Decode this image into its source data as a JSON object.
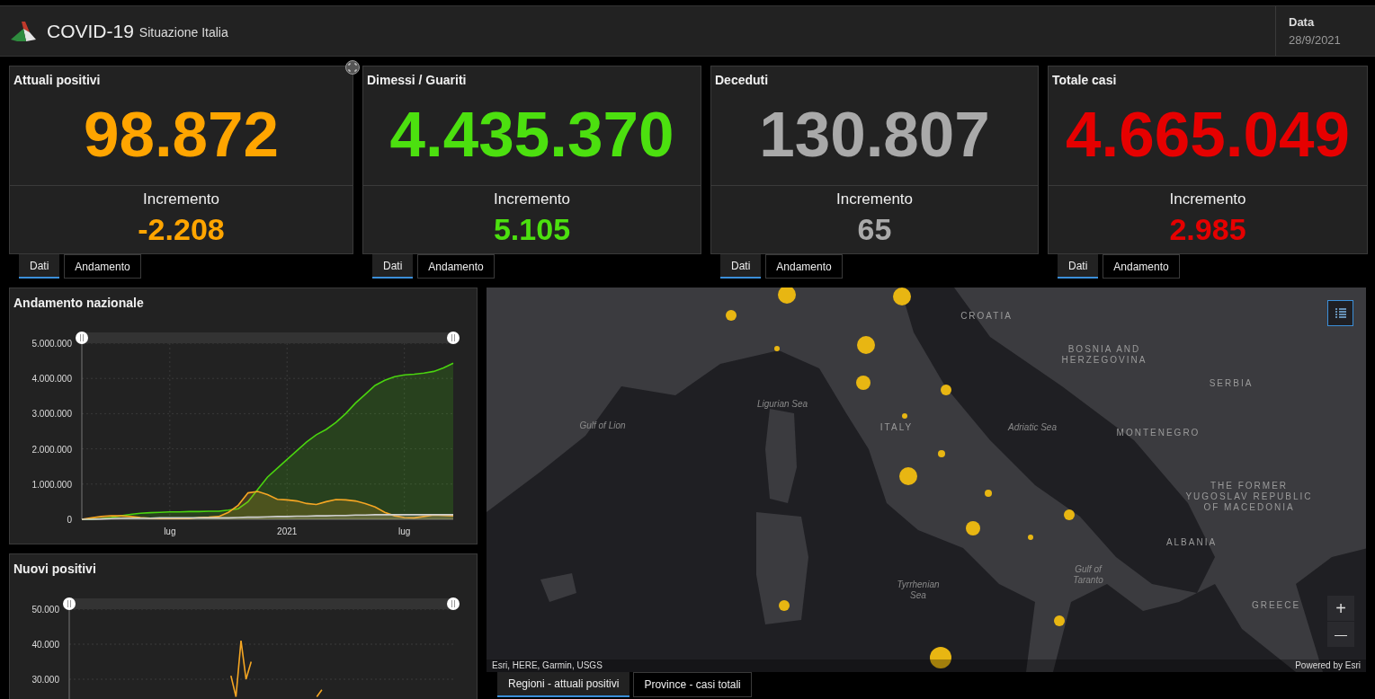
{
  "header": {
    "title": "COVID-19",
    "subtitle": "Situazione Italia",
    "date_label": "Data",
    "date_value": "28/9/2021"
  },
  "cards": [
    {
      "title": "Attuali positivi",
      "value": "98.872",
      "increment_label": "Incremento",
      "increment": "-2.208",
      "color": "#ffa500",
      "tabs": [
        {
          "label": "Dati",
          "selected": true
        },
        {
          "label": "Andamento",
          "selected": false
        }
      ]
    },
    {
      "title": "Dimessi / Guariti",
      "value": "4.435.370",
      "increment_label": "Incremento",
      "increment": "5.105",
      "color": "#4ce00f",
      "tabs": [
        {
          "label": "Dati",
          "selected": true
        },
        {
          "label": "Andamento",
          "selected": false
        }
      ]
    },
    {
      "title": "Deceduti",
      "value": "130.807",
      "increment_label": "Incremento",
      "increment": "65",
      "color": "#a9a9a9",
      "tabs": [
        {
          "label": "Dati",
          "selected": true
        },
        {
          "label": "Andamento",
          "selected": false
        }
      ]
    },
    {
      "title": "Totale casi",
      "value": "4.665.049",
      "increment_label": "Incremento",
      "increment": "2.985",
      "color": "#e60000",
      "tabs": [
        {
          "label": "Dati",
          "selected": true
        },
        {
          "label": "Andamento",
          "selected": false
        }
      ]
    }
  ],
  "charts": [
    {
      "title": "Andamento nazionale",
      "chart_data": {
        "type": "area",
        "categories": [
          null,
          null,
          null,
          null,
          null,
          null,
          null,
          null,
          null,
          "lug",
          null,
          null,
          null,
          null,
          null,
          null,
          null,
          null,
          null,
          null,
          null,
          "2021",
          null,
          null,
          null,
          null,
          null,
          null,
          null,
          null,
          null,
          null,
          null,
          "lug",
          null,
          null,
          null,
          null,
          null
        ],
        "ylim": [
          0,
          5000000
        ],
        "yticks": [
          {
            "value": 0,
            "label": "0"
          },
          {
            "value": 1000000,
            "label": "1.000.000"
          },
          {
            "value": 2000000,
            "label": "2.000.000"
          },
          {
            "value": 3000000,
            "label": "3.000.000"
          },
          {
            "value": 4000000,
            "label": "4.000.000"
          },
          {
            "value": 5000000,
            "label": "5.000.000"
          }
        ],
        "series": [
          {
            "color": "#4ad40f",
            "values": [
              0,
              10000,
              20000,
              50000,
              100000,
              140000,
              170000,
              190000,
              200000,
              210000,
              210000,
              220000,
              220000,
              230000,
              230000,
              260000,
              300000,
              500000,
              850000,
              1200000,
              1450000,
              1700000,
              1950000,
              2200000,
              2400000,
              2550000,
              2750000,
              3000000,
              3300000,
              3550000,
              3800000,
              3950000,
              4050000,
              4100000,
              4120000,
              4150000,
              4200000,
              4300000,
              4430000
            ]
          },
          {
            "color": "#f5a623",
            "values": [
              0,
              40000,
              80000,
              100000,
              100000,
              80000,
              50000,
              30000,
              20000,
              20000,
              20000,
              20000,
              50000,
              60000,
              80000,
              200000,
              400000,
              750000,
              790000,
              700000,
              570000,
              550000,
              520000,
              450000,
              420000,
              500000,
              560000,
              550000,
              520000,
              450000,
              350000,
              200000,
              100000,
              50000,
              40000,
              80000,
              120000,
              110000,
              100000
            ]
          },
          {
            "color": "#cfcfcf",
            "values": [
              0,
              0,
              10000,
              20000,
              30000,
              30000,
              30000,
              30000,
              40000,
              40000,
              40000,
              40000,
              40000,
              40000,
              40000,
              40000,
              50000,
              60000,
              60000,
              70000,
              80000,
              80000,
              90000,
              90000,
              100000,
              100000,
              110000,
              110000,
              120000,
              120000,
              130000,
              130000,
              130000,
              130000,
              130000,
              130000,
              130000,
              130000,
              130000
            ]
          }
        ],
        "grid": true
      }
    },
    {
      "title": "Nuovi positivi",
      "chart_data": {
        "type": "line",
        "categories": [
          null,
          null,
          null,
          null,
          null,
          null,
          null,
          null,
          null,
          null,
          null,
          null,
          null,
          null,
          null,
          null,
          null,
          null,
          null,
          null,
          null,
          null,
          null,
          null,
          null,
          null,
          null,
          null,
          null,
          null,
          null,
          null,
          null,
          null,
          null,
          null,
          null,
          null,
          null,
          null,
          null,
          null,
          null,
          null,
          null,
          null,
          null,
          null,
          null,
          null,
          null,
          null,
          null,
          null,
          null,
          null,
          null,
          null,
          null,
          null,
          null,
          null,
          null,
          null,
          null,
          null,
          null,
          null,
          null,
          null,
          null,
          null,
          null,
          null,
          null,
          null,
          null
        ],
        "ylim": [
          0,
          50000
        ],
        "yticks": [
          {
            "value": 30000,
            "label": "30.000"
          },
          {
            "value": 40000,
            "label": "40.000"
          },
          {
            "value": 50000,
            "label": "50.000"
          }
        ],
        "series": [
          {
            "color": "#f5a623",
            "values": [
              null,
              null,
              null,
              null,
              null,
              null,
              null,
              null,
              null,
              null,
              null,
              null,
              null,
              null,
              null,
              null,
              null,
              null,
              null,
              null,
              null,
              null,
              null,
              null,
              null,
              null,
              null,
              null,
              null,
              null,
              null,
              null,
              31000,
              25000,
              41000,
              30000,
              35000,
              null,
              null,
              null,
              null,
              null,
              null,
              null,
              null,
              null,
              null,
              null,
              null,
              25000,
              27000,
              null,
              null,
              null,
              null,
              null,
              null,
              null,
              null,
              null,
              null,
              null,
              null,
              null,
              null,
              null,
              null,
              null,
              null,
              null,
              null,
              null,
              null,
              null,
              null,
              null,
              null
            ]
          }
        ],
        "grid": true
      }
    }
  ],
  "map": {
    "labels": [
      {
        "text": "CROATIA",
        "kind": "country"
      },
      {
        "text": "BOSNIA AND HERZEGOVINA",
        "kind": "country"
      },
      {
        "text": "SERBIA",
        "kind": "country"
      },
      {
        "text": "Ligurian Sea",
        "kind": "sea"
      },
      {
        "text": "Gulf of Lion",
        "kind": "sea"
      },
      {
        "text": "ITALY",
        "kind": "country"
      },
      {
        "text": "Adriatic Sea",
        "kind": "sea"
      },
      {
        "text": "MONTENEGRO",
        "kind": "country"
      },
      {
        "text": "THE FORMER YUGOSLAV REPUBLIC OF MACEDONIA",
        "kind": "country"
      },
      {
        "text": "ALBANIA",
        "kind": "country"
      },
      {
        "text": "Tyrrhenian Sea",
        "kind": "sea"
      },
      {
        "text": "Gulf of Taranto",
        "kind": "sea"
      },
      {
        "text": "GREECE",
        "kind": "country"
      }
    ],
    "zoom_in": "+",
    "zoom_out": "—",
    "attribution": "Esri, HERE, Garmin, USGS",
    "powered_by": "Powered by Esri",
    "tabs": [
      {
        "label": "Regioni - attuali positivi",
        "selected": true
      },
      {
        "label": "Province - casi totali",
        "selected": false
      }
    ]
  }
}
